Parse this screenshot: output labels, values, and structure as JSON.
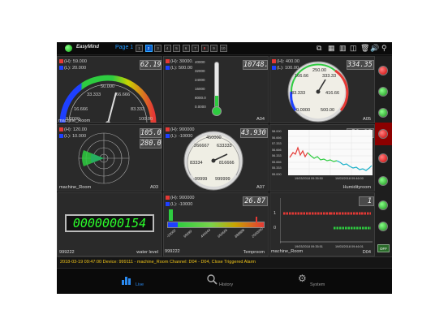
{
  "header": {
    "brand": "EasyMind",
    "page_label": "Page 1",
    "pages": [
      "1",
      "2",
      "3",
      "4",
      "5",
      "6",
      "7",
      "8",
      "9",
      "10"
    ],
    "selected_page": "2",
    "red_pages": [
      "8"
    ]
  },
  "gauges": {
    "g1": {
      "high": "(H): 59.000",
      "low": "(L): 20.000",
      "value": "62.19",
      "ticks": [
        "50.000",
        "33.333",
        "66.666",
        "16.666",
        "83.333",
        "0.0000",
        "100.00"
      ],
      "footer_left": "machine_Room",
      "footer_right": ""
    },
    "g2": {
      "high": "(H): 30000.",
      "low": "(L): 500.00",
      "value": "10748.",
      "scale": [
        "40000",
        "32000",
        "24000",
        "16000",
        "8000.0",
        "0.0000"
      ],
      "footer_left": "",
      "footer_right": "A04"
    },
    "g3": {
      "high": "(H): 400.00",
      "low": "(L): 100.00",
      "value": "334.35",
      "ticks": [
        "250.00",
        "166.66",
        "333.33",
        "83.333",
        "416.66",
        "0.0000",
        "500.00"
      ],
      "footer_left": "",
      "footer_right": "A05"
    },
    "g4": {
      "high": "(H): 120.00",
      "low": "(L): 10.000",
      "value1": "105.0",
      "value2": "280.0",
      "footer_left": "machine_Room",
      "footer_right": "A03"
    },
    "g5": {
      "high": "(H): 900000",
      "low": "(L): -10000",
      "value": "43.930",
      "ticks": [
        "450000",
        "266667",
        "633333",
        "83334",
        "816666",
        "-99999",
        "999999"
      ],
      "footer_left": "",
      "footer_right": "A07"
    },
    "g6": {
      "value": "58.13",
      "yticks": [
        "58.000",
        "56.666",
        "57.333",
        "56.666",
        "56.333",
        "55.666",
        "55.333",
        "55.000"
      ],
      "xstart": "19/03/2018 09:35:50",
      "xend": "19/03/2018 09:46:00",
      "footer_left": "",
      "footer_right": "Humidityroom"
    },
    "g7": {
      "counter": "0000000154",
      "footer_left": "999222",
      "footer_right": "water level"
    },
    "g8": {
      "high": "(H): 900000",
      "low": "(L): -10000",
      "value": "26.87",
      "xticks": [
        "-10000",
        "99999",
        "444444",
        "666666",
        "888888",
        "2000000"
      ],
      "footer_left": "999222",
      "footer_right": "Temproom"
    },
    "g9": {
      "value": "1",
      "y1": "1",
      "y0": "0",
      "xstart": "19/03/2018 09:35:51",
      "xend": "19/03/2018 09:46:01",
      "footer_left": "machine_Room",
      "footer_right": "D04"
    }
  },
  "side_off": "OFF",
  "alarm": "2018-03-19 09:47:00 Device: 999111 - machine_Room   Channel: D04 - D04, Close Triggered Alarm",
  "tabs": [
    {
      "label": "Live"
    },
    {
      "label": "History"
    },
    {
      "label": "System"
    }
  ],
  "colors": {
    "accent": "#1e88e5",
    "alarm_text": "#f0c419",
    "high": "#e53935",
    "low": "#1e40ff"
  }
}
